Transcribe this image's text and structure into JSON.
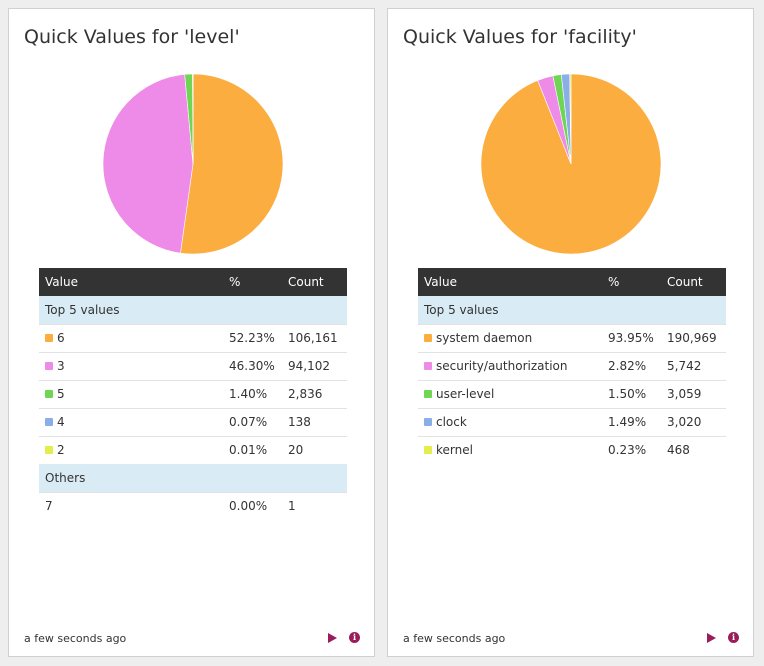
{
  "widgets": [
    {
      "title": "Quick Values for 'level'",
      "table_headers": {
        "value": "Value",
        "percent": "%",
        "count": "Count"
      },
      "top_label": "Top 5 values",
      "others_label": "Others",
      "rows": [
        {
          "value": "6",
          "percent": "52.23%",
          "count": "106,161",
          "color": "#fbad3f"
        },
        {
          "value": "3",
          "percent": "46.30%",
          "count": "94,102",
          "color": "#ee8ae8"
        },
        {
          "value": "5",
          "percent": "1.40%",
          "count": "2,836",
          "color": "#6fd555"
        },
        {
          "value": "4",
          "percent": "0.07%",
          "count": "138",
          "color": "#8aaee8"
        },
        {
          "value": "2",
          "percent": "0.01%",
          "count": "20",
          "color": "#e4ed4e"
        }
      ],
      "others_rows": [
        {
          "value": "7",
          "percent": "0.00%",
          "count": "1"
        }
      ],
      "footer_time": "a few seconds ago"
    },
    {
      "title": "Quick Values for 'facility'",
      "table_headers": {
        "value": "Value",
        "percent": "%",
        "count": "Count"
      },
      "top_label": "Top 5 values",
      "rows": [
        {
          "value": "system daemon",
          "percent": "93.95%",
          "count": "190,969",
          "color": "#fbad3f"
        },
        {
          "value": "security/authorization",
          "percent": "2.82%",
          "count": "5,742",
          "color": "#ee8ae8"
        },
        {
          "value": "user-level",
          "percent": "1.50%",
          "count": "3,059",
          "color": "#6fd555"
        },
        {
          "value": "clock",
          "percent": "1.49%",
          "count": "3,020",
          "color": "#8aaee8"
        },
        {
          "value": "kernel",
          "percent": "0.23%",
          "count": "468",
          "color": "#e4ed4e"
        }
      ],
      "footer_time": "a few seconds ago"
    }
  ],
  "chart_data": [
    {
      "type": "pie",
      "title": "Quick Values for 'level'",
      "labels": [
        "6",
        "3",
        "5",
        "4",
        "2",
        "7"
      ],
      "values": [
        106161,
        94102,
        2836,
        138,
        20,
        1
      ],
      "colors": [
        "#fbad3f",
        "#ee8ae8",
        "#6fd555",
        "#8aaee8",
        "#e4ed4e",
        "#cccccc"
      ]
    },
    {
      "type": "pie",
      "title": "Quick Values for 'facility'",
      "labels": [
        "system daemon",
        "security/authorization",
        "user-level",
        "clock",
        "kernel"
      ],
      "values": [
        190969,
        5742,
        3059,
        3020,
        468
      ],
      "colors": [
        "#fbad3f",
        "#ee8ae8",
        "#6fd555",
        "#8aaee8",
        "#e4ed4e"
      ]
    }
  ]
}
